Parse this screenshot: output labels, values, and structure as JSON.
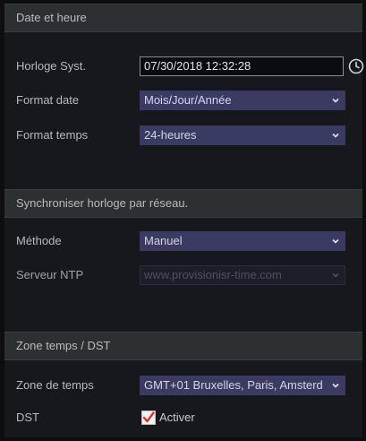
{
  "sections": {
    "datetime": {
      "title": "Date et heure"
    },
    "sync": {
      "title": "Synchroniser horloge par réseau."
    },
    "zone": {
      "title": "Zone temps / DST"
    }
  },
  "datetime": {
    "system_clock": {
      "label": "Horloge Syst.",
      "value": "07/30/2018 12:32:28"
    },
    "date_format": {
      "label": "Format date",
      "value": "Mois/Jour/Année"
    },
    "time_format": {
      "label": "Format temps",
      "value": "24-heures"
    }
  },
  "sync": {
    "method": {
      "label": "Méthode",
      "value": "Manuel"
    },
    "ntp_server": {
      "label": "Serveur NTP",
      "value": "www.provisionisr-time.com",
      "disabled": true
    }
  },
  "zone": {
    "timezone": {
      "label": "Zone de temps",
      "value": "GMT+01 Bruxelles, Paris, Amsterd"
    },
    "dst": {
      "label": "DST",
      "checkbox_label": "Activer",
      "checked": true
    }
  },
  "icons": {
    "clock": "clock-icon",
    "dropdown": "chevron-down-icon",
    "check": "check-icon"
  },
  "colors": {
    "background": "#17181d",
    "header": "#2d3032",
    "select": "#3a3b63",
    "check_mark": "#e0201b"
  }
}
